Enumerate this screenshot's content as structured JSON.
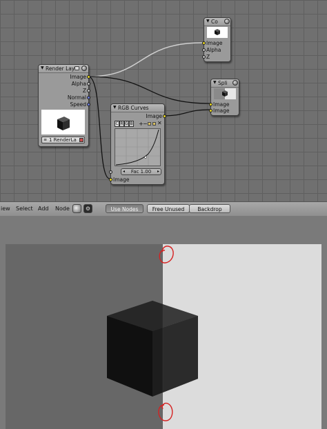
{
  "nodes": {
    "render_layers": {
      "title": "Render Laye",
      "outputs": [
        "Image",
        "Alpha",
        "Z",
        "Normal",
        "Speed"
      ],
      "layer_select": "1 RenderLa"
    },
    "composite": {
      "title": "Co",
      "inputs": [
        "Image",
        "Alpha",
        "Z"
      ]
    },
    "split": {
      "title": "Spli",
      "inputs": [
        "Image",
        "Image"
      ]
    },
    "rgb_curves": {
      "title": "RGB Curves",
      "output": "Image",
      "channels": [
        "C",
        "R",
        "G",
        "B"
      ],
      "fac_label": "Fac 1.00",
      "input": "Image"
    }
  },
  "header": {
    "menus": [
      "iew",
      "Select",
      "Add",
      "Node"
    ],
    "use_nodes_label": "Use Nodes",
    "free_unused_label": "Free Unused",
    "backdrop_label": "Backdrop"
  },
  "colors": {
    "socket_image": "#e8d620",
    "socket_value": "#bbbbbb",
    "socket_vector": "#6a7ad8",
    "annotation": "#d62020"
  }
}
